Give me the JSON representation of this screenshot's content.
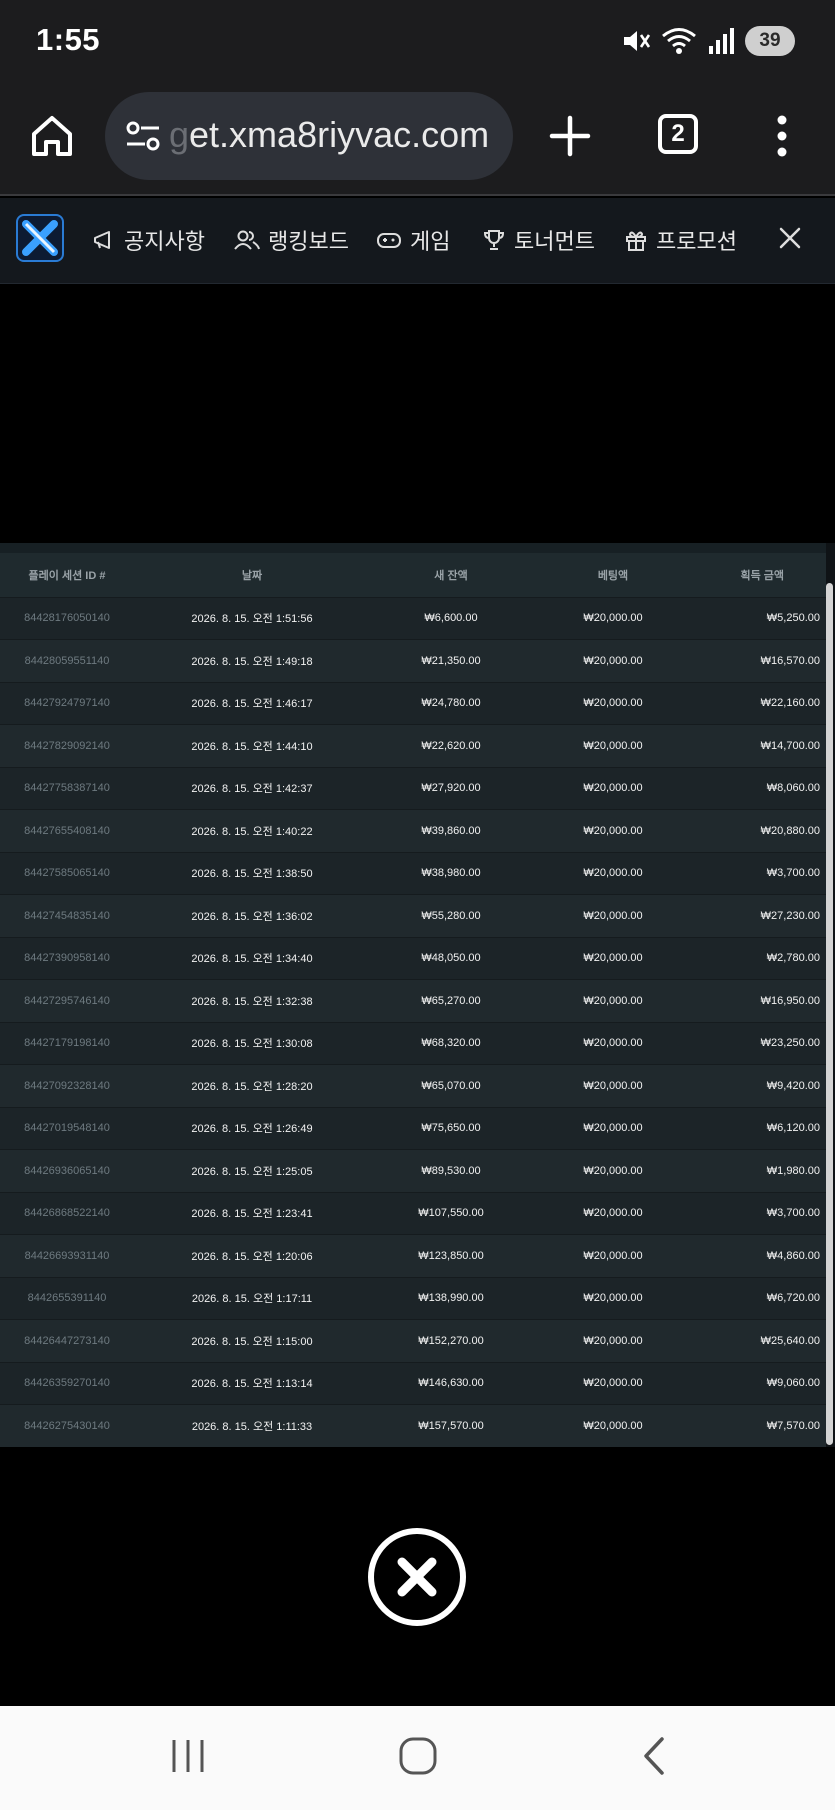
{
  "status": {
    "time": "1:55",
    "battery": "39"
  },
  "browser": {
    "url_faded": "g",
    "url": "et.xma8riyvac.com",
    "tab_count": "2"
  },
  "sitenav": {
    "items": [
      {
        "label": "공지사항",
        "icon": "megaphone-icon"
      },
      {
        "label": "랭킹보드",
        "icon": "users-icon"
      },
      {
        "label": "게임",
        "icon": "gamepad-icon"
      },
      {
        "label": "토너먼트",
        "icon": "trophy-icon"
      },
      {
        "label": "프로모션",
        "icon": "gift-icon"
      }
    ]
  },
  "table": {
    "headers": [
      "플레이 세션 ID #",
      "날짜",
      "새 잔액",
      "베팅액",
      "획득 금액"
    ],
    "rows": [
      [
        "84428176050140",
        "2026. 8. 15. 오전 1:51:56",
        "₩6,600.00",
        "₩20,000.00",
        "₩5,250.00"
      ],
      [
        "84428059551140",
        "2026. 8. 15. 오전 1:49:18",
        "₩21,350.00",
        "₩20,000.00",
        "₩16,570.00"
      ],
      [
        "84427924797140",
        "2026. 8. 15. 오전 1:46:17",
        "₩24,780.00",
        "₩20,000.00",
        "₩22,160.00"
      ],
      [
        "84427829092140",
        "2026. 8. 15. 오전 1:44:10",
        "₩22,620.00",
        "₩20,000.00",
        "₩14,700.00"
      ],
      [
        "84427758387140",
        "2026. 8. 15. 오전 1:42:37",
        "₩27,920.00",
        "₩20,000.00",
        "₩8,060.00"
      ],
      [
        "84427655408140",
        "2026. 8. 15. 오전 1:40:22",
        "₩39,860.00",
        "₩20,000.00",
        "₩20,880.00"
      ],
      [
        "84427585065140",
        "2026. 8. 15. 오전 1:38:50",
        "₩38,980.00",
        "₩20,000.00",
        "₩3,700.00"
      ],
      [
        "84427454835140",
        "2026. 8. 15. 오전 1:36:02",
        "₩55,280.00",
        "₩20,000.00",
        "₩27,230.00"
      ],
      [
        "84427390958140",
        "2026. 8. 15. 오전 1:34:40",
        "₩48,050.00",
        "₩20,000.00",
        "₩2,780.00"
      ],
      [
        "84427295746140",
        "2026. 8. 15. 오전 1:32:38",
        "₩65,270.00",
        "₩20,000.00",
        "₩16,950.00"
      ],
      [
        "84427179198140",
        "2026. 8. 15. 오전 1:30:08",
        "₩68,320.00",
        "₩20,000.00",
        "₩23,250.00"
      ],
      [
        "84427092328140",
        "2026. 8. 15. 오전 1:28:20",
        "₩65,070.00",
        "₩20,000.00",
        "₩9,420.00"
      ],
      [
        "84427019548140",
        "2026. 8. 15. 오전 1:26:49",
        "₩75,650.00",
        "₩20,000.00",
        "₩6,120.00"
      ],
      [
        "84426936065140",
        "2026. 8. 15. 오전 1:25:05",
        "₩89,530.00",
        "₩20,000.00",
        "₩1,980.00"
      ],
      [
        "84426868522140",
        "2026. 8. 15. 오전 1:23:41",
        "₩107,550.00",
        "₩20,000.00",
        "₩3,700.00"
      ],
      [
        "84426693931140",
        "2026. 8. 15. 오전 1:20:06",
        "₩123,850.00",
        "₩20,000.00",
        "₩4,860.00"
      ],
      [
        "8442655391140",
        "2026. 8. 15. 오전 1:17:11",
        "₩138,990.00",
        "₩20,000.00",
        "₩6,720.00"
      ],
      [
        "84426447273140",
        "2026. 8. 15. 오전 1:15:00",
        "₩152,270.00",
        "₩20,000.00",
        "₩25,640.00"
      ],
      [
        "84426359270140",
        "2026. 8. 15. 오전 1:13:14",
        "₩146,630.00",
        "₩20,000.00",
        "₩9,060.00"
      ],
      [
        "84426275430140",
        "2026. 8. 15. 오전 1:11:33",
        "₩157,570.00",
        "₩20,000.00",
        "₩7,570.00"
      ]
    ]
  },
  "colors": {
    "status_bg": "#1c1c1e",
    "nav_bg": "#14181d",
    "table_bg": "#1d2428",
    "logo_accent": "#2a7bd4"
  }
}
